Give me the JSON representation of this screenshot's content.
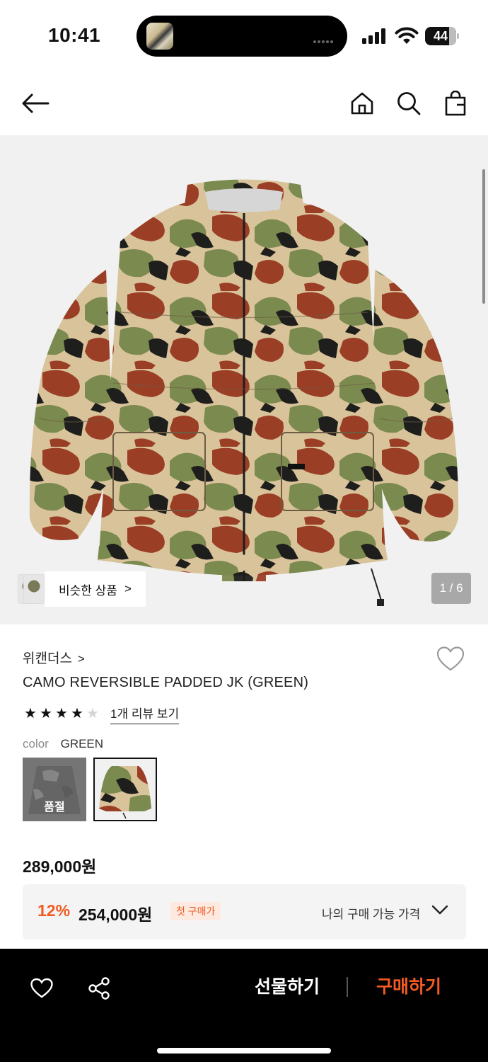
{
  "status_bar": {
    "time": "10:41",
    "battery": "44"
  },
  "nav": {
    "icons": [
      "back-arrow-icon",
      "home-icon",
      "search-icon",
      "shopping-bag-icon"
    ]
  },
  "gallery": {
    "similar_label": "비슷한 상품",
    "chevron": ">",
    "counter": "1 / 6"
  },
  "product": {
    "brand": "위캔더스",
    "brand_chevron": ">",
    "title": "CAMO REVERSIBLE PADDED JK (GREEN)",
    "rating": 4,
    "rating_max": 5,
    "review_link": "1개 리뷰 보기",
    "color_label": "color",
    "color_value": "GREEN",
    "swatches": [
      {
        "name": "black-camo",
        "sold_out_label": "품절"
      },
      {
        "name": "green-camo",
        "selected": true
      }
    ],
    "price": "289,000원",
    "discount": {
      "rate": "12%",
      "price": "254,000원",
      "badge": "첫 구매가",
      "my_price_label": "나의 구매 가능 가격"
    }
  },
  "bottom_bar": {
    "gift_label": "선물하기",
    "buy_label": "구매하기"
  },
  "colors": {
    "accent": "#f25a22",
    "bottom_bar_bg": "#000000",
    "image_bg": "#f1f1f1"
  }
}
